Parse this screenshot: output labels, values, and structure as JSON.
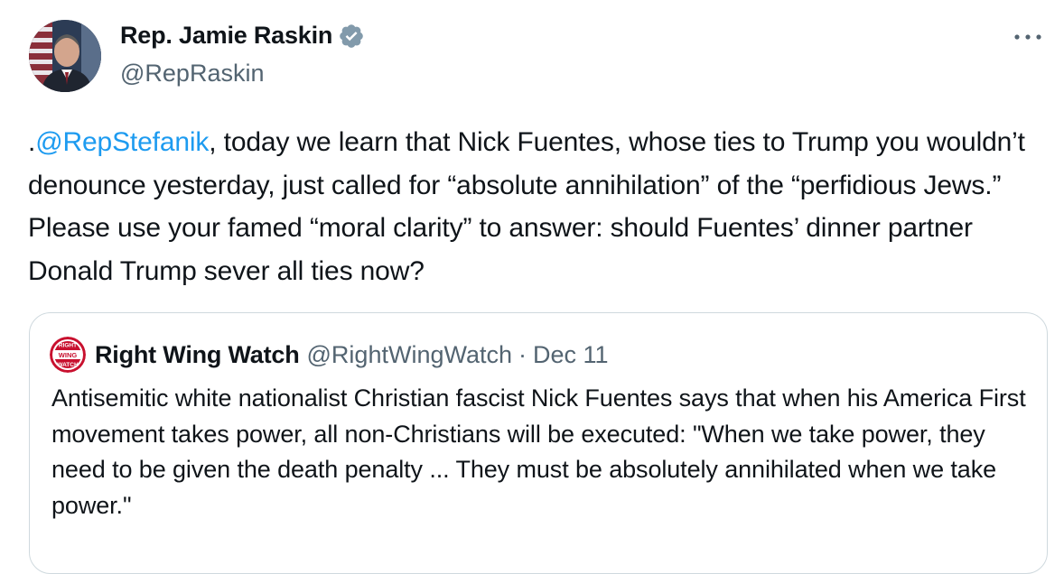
{
  "author": {
    "display_name": "Rep. Jamie Raskin",
    "handle": "@RepRaskin",
    "verified": true,
    "verified_color": "#829aab"
  },
  "menu": {
    "icon": "more-horizontal-icon"
  },
  "tweet": {
    "prefix": ".",
    "mention": "@RepStefanik",
    "body": ", today we learn that Nick Fuentes, whose ties to Trump you wouldn’t denounce yesterday, just called for “absolute annihilation” of the “perfidious Jews.” Please use your famed “moral clarity” to answer: should Fuentes’ dinner partner Donald Trump sever all ties now?",
    "mention_color": "#1d9bf0"
  },
  "quote": {
    "avatar_text_top": "RIGHT",
    "avatar_text_mid": "WING",
    "avatar_text_bottom": "WATCH",
    "display_name": "Right Wing Watch",
    "handle": "@RightWingWatch",
    "separator": "·",
    "date": "Dec 11",
    "text": "Antisemitic white nationalist Christian fascist Nick Fuentes says that when his America First movement takes power, all non-Christians will be executed: \"When we take power, they need to be given the death penalty ... They must be absolutely annihilated when we take power.\""
  }
}
